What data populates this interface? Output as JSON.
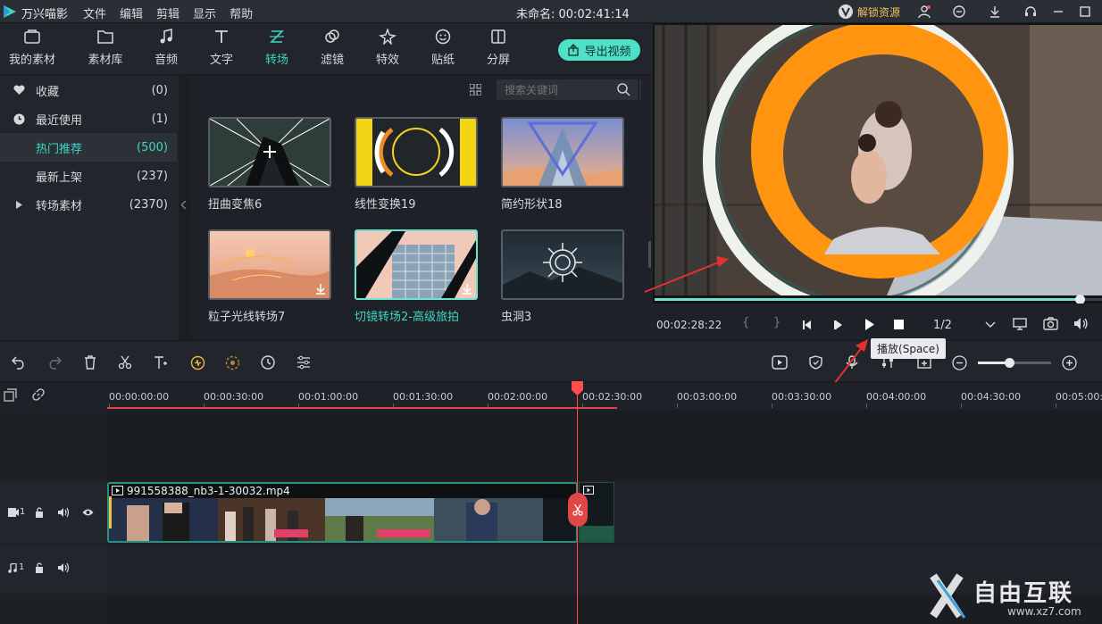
{
  "app": {
    "name": "万兴喵影",
    "doc_title": "未命名: 00:02:41:14",
    "unlock_label": "解锁资源"
  },
  "menu": [
    "文件",
    "编辑",
    "剪辑",
    "显示",
    "帮助"
  ],
  "tabs": [
    {
      "label": "我的素材",
      "icon": "folder-box-icon"
    },
    {
      "label": "素材库",
      "icon": "folder-icon"
    },
    {
      "label": "音频",
      "icon": "music-note-icon"
    },
    {
      "label": "文字",
      "icon": "text-t-icon"
    },
    {
      "label": "转场",
      "icon": "transition-icon",
      "active": true
    },
    {
      "label": "滤镜",
      "icon": "filter-icon"
    },
    {
      "label": "特效",
      "icon": "sparkle-icon"
    },
    {
      "label": "贴纸",
      "icon": "sticker-icon"
    },
    {
      "label": "分屏",
      "icon": "split-screen-icon"
    }
  ],
  "export_label": "导出视频",
  "categories": [
    {
      "label": "收藏",
      "count": "(0)",
      "icon": "heart-icon"
    },
    {
      "label": "最近使用",
      "count": "(1)",
      "icon": "clock-icon"
    },
    {
      "label": "热门推荐",
      "count": "(500)",
      "active": true
    },
    {
      "label": "最新上架",
      "count": "(237)"
    },
    {
      "label": "转场素材",
      "count": "(2370)",
      "icon": "triangle-right-icon"
    }
  ],
  "search_placeholder": "搜索关键词",
  "transitions": [
    {
      "label": "扭曲变焦6"
    },
    {
      "label": "线性变换19"
    },
    {
      "label": "简约形状18"
    },
    {
      "label": "粒子光线转场7",
      "download": true
    },
    {
      "label": "切镜转场2-高级旅拍",
      "download": true,
      "selected": true
    },
    {
      "label": "虫洞3"
    }
  ],
  "player": {
    "current_time": "00:02:28:22",
    "page": "1/2",
    "progress": 0.95,
    "tooltip": "播放(Space)"
  },
  "ruler_ticks": [
    "00:00:00:00",
    "00:00:30:00",
    "00:01:00:00",
    "00:01:30:00",
    "00:02:00:00",
    "00:02:30:00",
    "00:03:00:00",
    "00:03:30:00",
    "00:04:00:00",
    "00:04:30:00",
    "00:05:00:00"
  ],
  "clip": {
    "name": "991558388_nb3-1-30032.mp4"
  },
  "tracks": [
    {
      "id": "1",
      "type": "video"
    },
    {
      "id": "1",
      "type": "audio"
    }
  ],
  "watermark": {
    "brand": "自由互联",
    "url": "www.xz7.com"
  },
  "colors": {
    "accent": "#3fd6c2",
    "playhead": "#ff4d4d",
    "ring": "#ff9410"
  }
}
